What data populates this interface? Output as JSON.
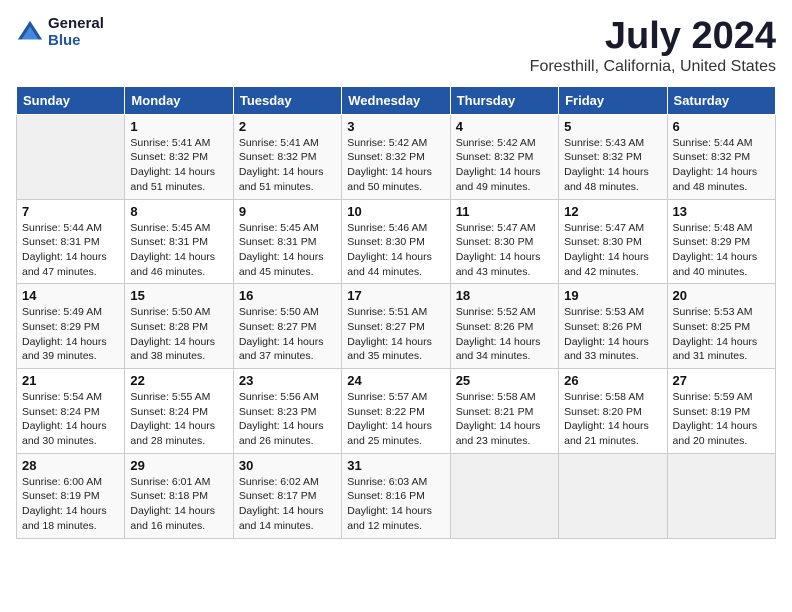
{
  "header": {
    "logo_general": "General",
    "logo_blue": "Blue",
    "month_title": "July 2024",
    "location": "Foresthill, California, United States"
  },
  "calendar": {
    "days_of_week": [
      "Sunday",
      "Monday",
      "Tuesday",
      "Wednesday",
      "Thursday",
      "Friday",
      "Saturday"
    ],
    "weeks": [
      [
        {
          "day": "",
          "info": ""
        },
        {
          "day": "1",
          "info": "Sunrise: 5:41 AM\nSunset: 8:32 PM\nDaylight: 14 hours\nand 51 minutes."
        },
        {
          "day": "2",
          "info": "Sunrise: 5:41 AM\nSunset: 8:32 PM\nDaylight: 14 hours\nand 51 minutes."
        },
        {
          "day": "3",
          "info": "Sunrise: 5:42 AM\nSunset: 8:32 PM\nDaylight: 14 hours\nand 50 minutes."
        },
        {
          "day": "4",
          "info": "Sunrise: 5:42 AM\nSunset: 8:32 PM\nDaylight: 14 hours\nand 49 minutes."
        },
        {
          "day": "5",
          "info": "Sunrise: 5:43 AM\nSunset: 8:32 PM\nDaylight: 14 hours\nand 48 minutes."
        },
        {
          "day": "6",
          "info": "Sunrise: 5:44 AM\nSunset: 8:32 PM\nDaylight: 14 hours\nand 48 minutes."
        }
      ],
      [
        {
          "day": "7",
          "info": "Sunrise: 5:44 AM\nSunset: 8:31 PM\nDaylight: 14 hours\nand 47 minutes."
        },
        {
          "day": "8",
          "info": "Sunrise: 5:45 AM\nSunset: 8:31 PM\nDaylight: 14 hours\nand 46 minutes."
        },
        {
          "day": "9",
          "info": "Sunrise: 5:45 AM\nSunset: 8:31 PM\nDaylight: 14 hours\nand 45 minutes."
        },
        {
          "day": "10",
          "info": "Sunrise: 5:46 AM\nSunset: 8:30 PM\nDaylight: 14 hours\nand 44 minutes."
        },
        {
          "day": "11",
          "info": "Sunrise: 5:47 AM\nSunset: 8:30 PM\nDaylight: 14 hours\nand 43 minutes."
        },
        {
          "day": "12",
          "info": "Sunrise: 5:47 AM\nSunset: 8:30 PM\nDaylight: 14 hours\nand 42 minutes."
        },
        {
          "day": "13",
          "info": "Sunrise: 5:48 AM\nSunset: 8:29 PM\nDaylight: 14 hours\nand 40 minutes."
        }
      ],
      [
        {
          "day": "14",
          "info": "Sunrise: 5:49 AM\nSunset: 8:29 PM\nDaylight: 14 hours\nand 39 minutes."
        },
        {
          "day": "15",
          "info": "Sunrise: 5:50 AM\nSunset: 8:28 PM\nDaylight: 14 hours\nand 38 minutes."
        },
        {
          "day": "16",
          "info": "Sunrise: 5:50 AM\nSunset: 8:27 PM\nDaylight: 14 hours\nand 37 minutes."
        },
        {
          "day": "17",
          "info": "Sunrise: 5:51 AM\nSunset: 8:27 PM\nDaylight: 14 hours\nand 35 minutes."
        },
        {
          "day": "18",
          "info": "Sunrise: 5:52 AM\nSunset: 8:26 PM\nDaylight: 14 hours\nand 34 minutes."
        },
        {
          "day": "19",
          "info": "Sunrise: 5:53 AM\nSunset: 8:26 PM\nDaylight: 14 hours\nand 33 minutes."
        },
        {
          "day": "20",
          "info": "Sunrise: 5:53 AM\nSunset: 8:25 PM\nDaylight: 14 hours\nand 31 minutes."
        }
      ],
      [
        {
          "day": "21",
          "info": "Sunrise: 5:54 AM\nSunset: 8:24 PM\nDaylight: 14 hours\nand 30 minutes."
        },
        {
          "day": "22",
          "info": "Sunrise: 5:55 AM\nSunset: 8:24 PM\nDaylight: 14 hours\nand 28 minutes."
        },
        {
          "day": "23",
          "info": "Sunrise: 5:56 AM\nSunset: 8:23 PM\nDaylight: 14 hours\nand 26 minutes."
        },
        {
          "day": "24",
          "info": "Sunrise: 5:57 AM\nSunset: 8:22 PM\nDaylight: 14 hours\nand 25 minutes."
        },
        {
          "day": "25",
          "info": "Sunrise: 5:58 AM\nSunset: 8:21 PM\nDaylight: 14 hours\nand 23 minutes."
        },
        {
          "day": "26",
          "info": "Sunrise: 5:58 AM\nSunset: 8:20 PM\nDaylight: 14 hours\nand 21 minutes."
        },
        {
          "day": "27",
          "info": "Sunrise: 5:59 AM\nSunset: 8:19 PM\nDaylight: 14 hours\nand 20 minutes."
        }
      ],
      [
        {
          "day": "28",
          "info": "Sunrise: 6:00 AM\nSunset: 8:19 PM\nDaylight: 14 hours\nand 18 minutes."
        },
        {
          "day": "29",
          "info": "Sunrise: 6:01 AM\nSunset: 8:18 PM\nDaylight: 14 hours\nand 16 minutes."
        },
        {
          "day": "30",
          "info": "Sunrise: 6:02 AM\nSunset: 8:17 PM\nDaylight: 14 hours\nand 14 minutes."
        },
        {
          "day": "31",
          "info": "Sunrise: 6:03 AM\nSunset: 8:16 PM\nDaylight: 14 hours\nand 12 minutes."
        },
        {
          "day": "",
          "info": ""
        },
        {
          "day": "",
          "info": ""
        },
        {
          "day": "",
          "info": ""
        }
      ]
    ]
  }
}
